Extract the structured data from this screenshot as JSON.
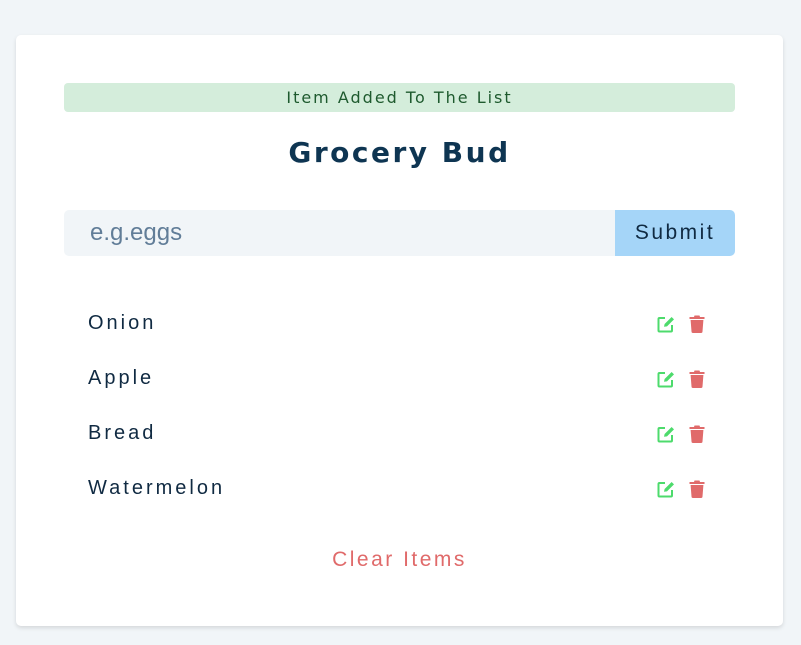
{
  "alert": {
    "text": "Item Added To The List",
    "type": "success"
  },
  "app": {
    "title": "Grocery Bud"
  },
  "form": {
    "placeholder": "e.g.eggs",
    "value": "",
    "submit_label": "Submit"
  },
  "items": [
    {
      "label": "Onion"
    },
    {
      "label": "Apple"
    },
    {
      "label": "Bread"
    },
    {
      "label": "Watermelon"
    }
  ],
  "icons": {
    "edit": "edit-icon",
    "delete": "trash-icon"
  },
  "clear_label": "Clear Items",
  "colors": {
    "background": "#f1f5f8",
    "card": "#ffffff",
    "alert_bg": "#d4eddb",
    "alert_text": "#1e5a2e",
    "title": "#0e3552",
    "input_bg": "#f1f5f8",
    "submit_bg": "#a5d5f8",
    "edit_icon": "#4ddb6c",
    "delete_icon": "#e06a6a",
    "clear_text": "#e06a6a"
  }
}
